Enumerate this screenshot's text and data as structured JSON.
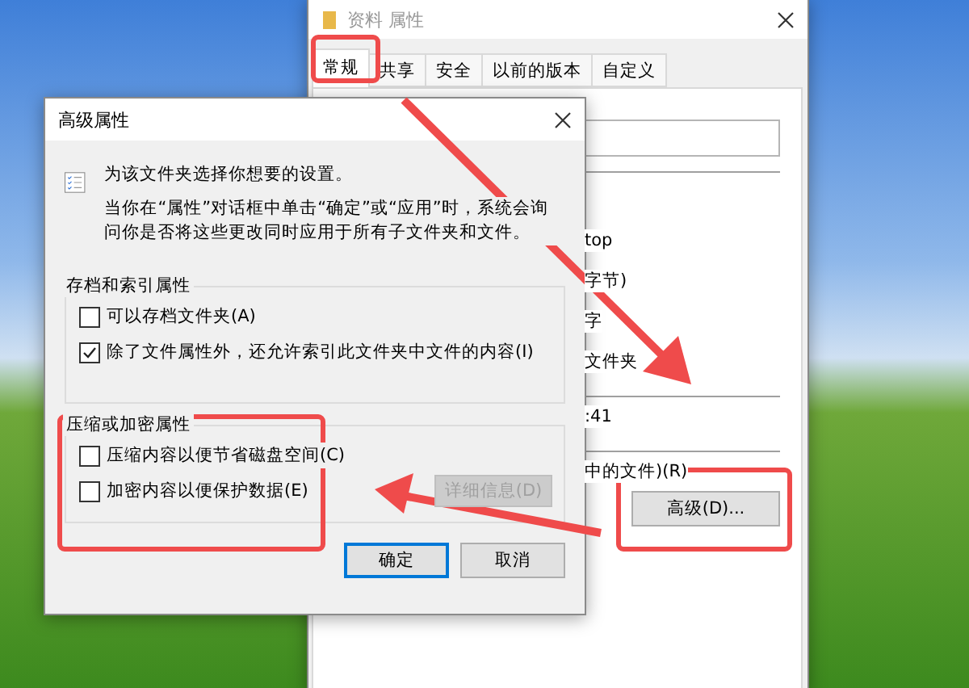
{
  "properties_window": {
    "title": "资料 属性",
    "active": false,
    "tabs": [
      {
        "label": "常规",
        "selected": true
      },
      {
        "label": "共享",
        "selected": false
      },
      {
        "label": "安全",
        "selected": false
      },
      {
        "label": "以前的版本",
        "selected": false
      },
      {
        "label": "自定义",
        "selected": false
      }
    ],
    "visible_texts": [
      {
        "kind": "gap",
        "text": "top"
      },
      {
        "kind": "line",
        "text": "字节)"
      },
      {
        "kind": "line",
        "text": "字"
      },
      {
        "kind": "line",
        "text": "文件夹"
      },
      {
        "kind": "rule",
        "text": ":41"
      },
      {
        "kind": "rule",
        "text": "中的文件)(R)"
      }
    ],
    "advanced_button": "高级(D)..."
  },
  "advanced_dialog": {
    "title": "高级属性",
    "intro": "为该文件夹选择你想要的设置。",
    "note": "当你在“属性”对话框中单击“确定”或“应用”时，系统会询问你是否将这些更改同时应用于所有子文件夹和文件。",
    "groups": [
      {
        "title": "存档和索引属性",
        "options": [
          {
            "label": "可以存档文件夹(A)",
            "checked": false
          },
          {
            "label": "除了文件属性外，还允许索引此文件夹中文件的内容(I)",
            "checked": true
          }
        ]
      },
      {
        "title": "压缩或加密属性",
        "options": [
          {
            "label": "压缩内容以便节省磁盘空间(C)",
            "checked": false
          },
          {
            "label": "加密内容以便保护数据(E)",
            "checked": false
          }
        ],
        "button": {
          "label": "详细信息(D)",
          "disabled": true
        }
      }
    ],
    "buttons": [
      {
        "label": "确定",
        "default": true
      },
      {
        "label": "取消",
        "default": false
      }
    ]
  }
}
